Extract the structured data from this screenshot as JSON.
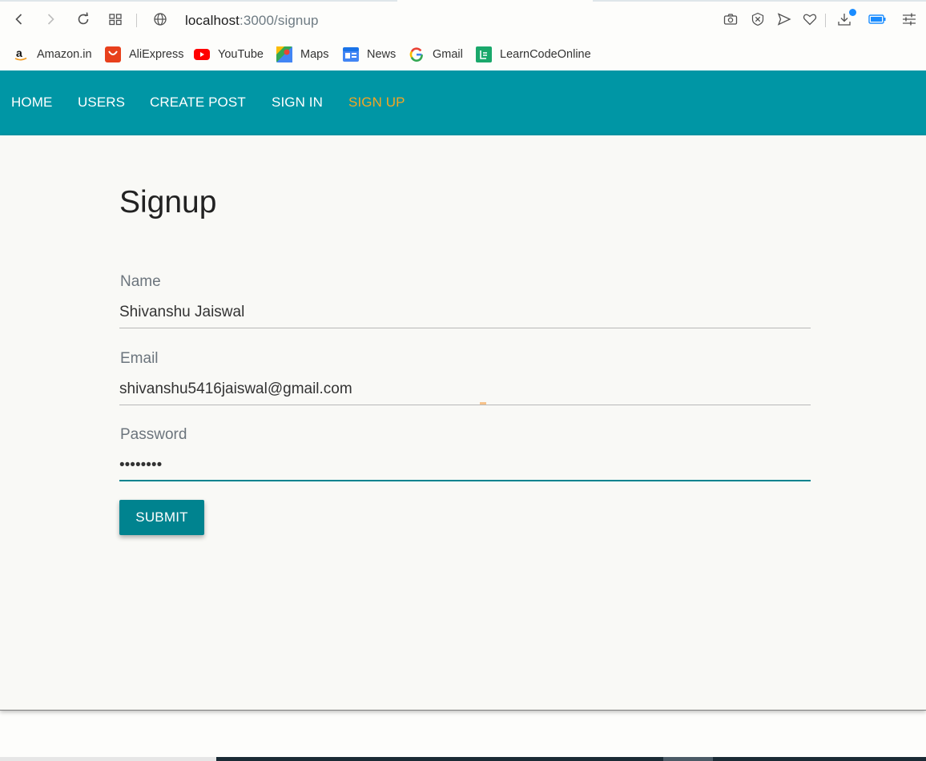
{
  "browser": {
    "url_host": "localhost",
    "url_path": ":3000/signup",
    "icons": [
      "back-icon",
      "forward-icon",
      "reload-icon",
      "speed-dial-icon",
      "site-info-icon",
      "camera-icon",
      "block-icon",
      "send-icon",
      "heart-icon",
      "download-icon",
      "battery-icon",
      "settings-sliders-icon"
    ],
    "bookmarks": [
      {
        "label": "Amazon.in",
        "icon": "amazon-icon"
      },
      {
        "label": "AliExpress",
        "icon": "aliexpress-icon"
      },
      {
        "label": "YouTube",
        "icon": "youtube-icon"
      },
      {
        "label": "Maps",
        "icon": "maps-icon"
      },
      {
        "label": "News",
        "icon": "news-icon"
      },
      {
        "label": "Gmail",
        "icon": "google-icon"
      },
      {
        "label": "LearnCodeOnline",
        "icon": "learncodeonline-icon"
      }
    ]
  },
  "nav": {
    "links": [
      "HOME",
      "USERS",
      "CREATE POST",
      "SIGN IN",
      "SIGN UP"
    ],
    "active": "SIGN UP",
    "bg_color": "#0096a5",
    "active_color": "#f5a623"
  },
  "form": {
    "title": "Signup",
    "name_label": "Name",
    "name_value": "Shivanshu Jaiswal",
    "email_label": "Email",
    "email_value": "shivanshu5416jaiswal@gmail.com",
    "password_label": "Password",
    "password_value": "••••••••",
    "submit_label": "SUBMIT",
    "accent_color": "#00838f"
  }
}
